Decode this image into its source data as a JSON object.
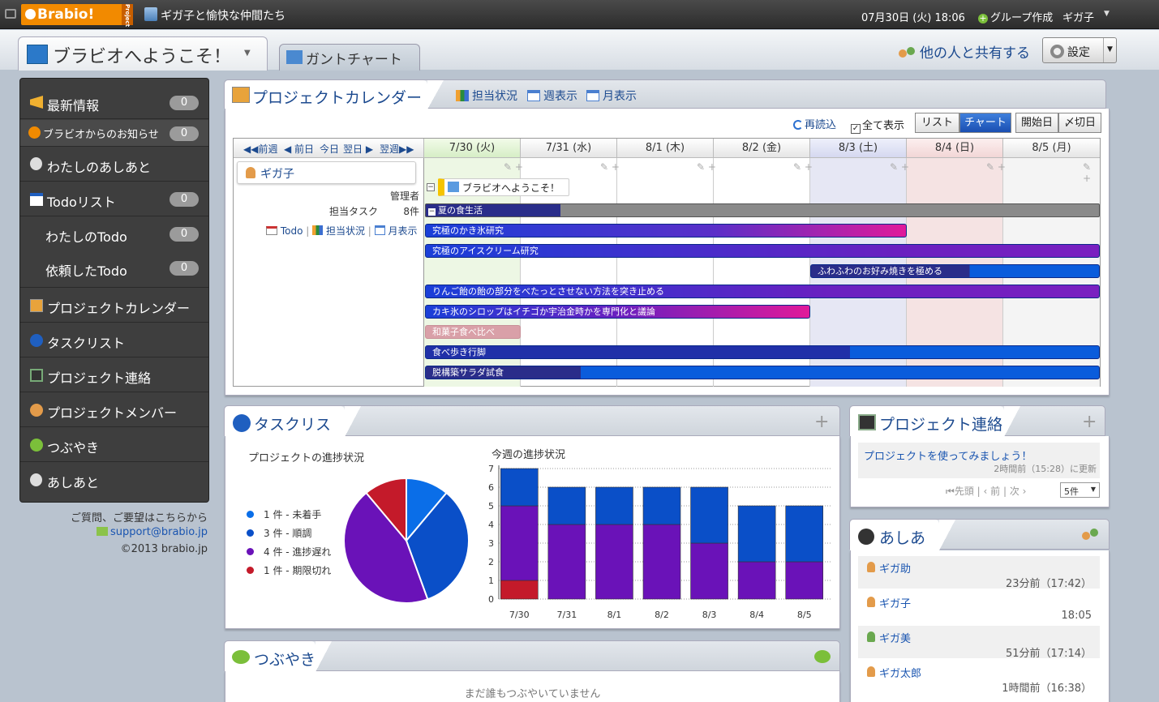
{
  "topbar": {
    "logo": "Brabio!",
    "logo_sub": "Project",
    "group_name": "ギガ子と愉快な仲間たち",
    "datetime": "07月30日 (火) 18:06",
    "create_group": "グループ作成",
    "user": "ギガ子"
  },
  "header": {
    "tab_welcome": "ブラビオへようこそ！",
    "tab_gantt": "ガントチャート",
    "share": "他の人と共有する",
    "settings": "設定"
  },
  "sidebar": {
    "items": [
      {
        "label": "最新情報",
        "count": "0"
      },
      {
        "label": "ブラビオからのお知らせ",
        "count": "0"
      },
      {
        "label": "わたしのあしあと"
      },
      {
        "label": "Todoリスト",
        "count": "0"
      },
      {
        "label": "わたしのTodo",
        "count": "0"
      },
      {
        "label": "依頼したTodo",
        "count": "0"
      },
      {
        "label": "プロジェクトカレンダー"
      },
      {
        "label": "タスクリスト"
      },
      {
        "label": "プロジェクト連絡"
      },
      {
        "label": "プロジェクトメンバー"
      },
      {
        "label": "つぶやき"
      },
      {
        "label": "あしあと"
      }
    ],
    "help_text": "ご質問、ご要望はこちらから",
    "support_email": "support@brabio.jp",
    "copyright": "©2013 brabio.jp"
  },
  "calendar": {
    "title": "プロジェクトカレンダー",
    "tabs": [
      "担当状況",
      "週表示",
      "月表示"
    ],
    "reload": "再読込",
    "show_all": "全て表示",
    "view_buttons": [
      "リスト",
      "チャート",
      "開始日",
      "〆切日"
    ],
    "nav": [
      "前週",
      "前日",
      "今日",
      "翌日",
      "翌週"
    ],
    "days": [
      "7/30 (火)",
      "7/31 (水)",
      "8/1 (木)",
      "8/2 (金)",
      "8/3 (土)",
      "8/4 (日)",
      "8/5 (月)"
    ],
    "member": "ギガ子",
    "role": "管理者",
    "task_label": "担当タスク",
    "task_count": "8件",
    "member_links": [
      "Todo",
      "担当状況",
      "月表示"
    ],
    "project_label": "ブラビオへようこそ！",
    "tasks": [
      "夏の食生活",
      "究極のかき氷研究",
      "究極のアイスクリーム研究",
      "ふわふわのお好み焼きを極める",
      "りんご飴の飴の部分をべたっとさせない方法を突き止める",
      "カキ氷のシロップはイチゴか宇治金時かを専門化と議論",
      "和菓子食べ比べ",
      "食べ歩き行脚",
      "脱構築サラダ試食"
    ]
  },
  "tasklist": {
    "title": "タスクリスト",
    "pie_title": "プロジェクトの進捗状況",
    "bar_title": "今週の進捗状況",
    "legend": [
      "1 件 - 未着手",
      "3 件 - 順調",
      "4 件 - 進捗遅れ",
      "1 件 - 期限切れ"
    ],
    "colors": {
      "not_started": "#0a6ee8",
      "on_track": "#0a4fc8",
      "delayed": "#6a12b8",
      "overdue": "#c41a2a"
    }
  },
  "chart_data": [
    {
      "type": "pie",
      "title": "プロジェクトの進捗状況",
      "categories": [
        "未着手",
        "順調",
        "進捗遅れ",
        "期限切れ"
      ],
      "values": [
        1,
        3,
        4,
        1
      ]
    },
    {
      "type": "bar",
      "title": "今週の進捗状況",
      "categories": [
        "7/30",
        "7/31",
        "8/1",
        "8/2",
        "8/3",
        "8/4",
        "8/5"
      ],
      "series": [
        {
          "values": [
            1,
            0,
            0,
            0,
            0,
            0,
            0
          ]
        },
        {
          "values": [
            4,
            4,
            4,
            4,
            3,
            2,
            2
          ]
        },
        {
          "values": [
            2,
            2,
            2,
            2,
            3,
            3,
            3
          ]
        }
      ],
      "stacked": true,
      "ylim": [
        0,
        7
      ],
      "yticks": [
        0,
        1,
        2,
        3,
        4,
        5,
        6,
        7
      ]
    }
  ],
  "contact": {
    "title": "プロジェクト連絡",
    "item_title": "プロジェクトを使ってみましょう！",
    "item_time": "2時間前（15:28）に更新",
    "pager": [
      "先頭",
      "前",
      "次"
    ],
    "per_page": "5件"
  },
  "footprints": {
    "title": "あしあと",
    "items": [
      {
        "name": "ギガ助",
        "time": "23分前（17:42）"
      },
      {
        "name": "ギガ子",
        "time": "18:05"
      },
      {
        "name": "ギガ美",
        "time": "51分前（17:14）"
      },
      {
        "name": "ギガ太郎",
        "time": "1時間前（16:38）"
      }
    ]
  },
  "tweets": {
    "title": "つぶやき",
    "empty": "まだ誰もつぶやいていません"
  }
}
